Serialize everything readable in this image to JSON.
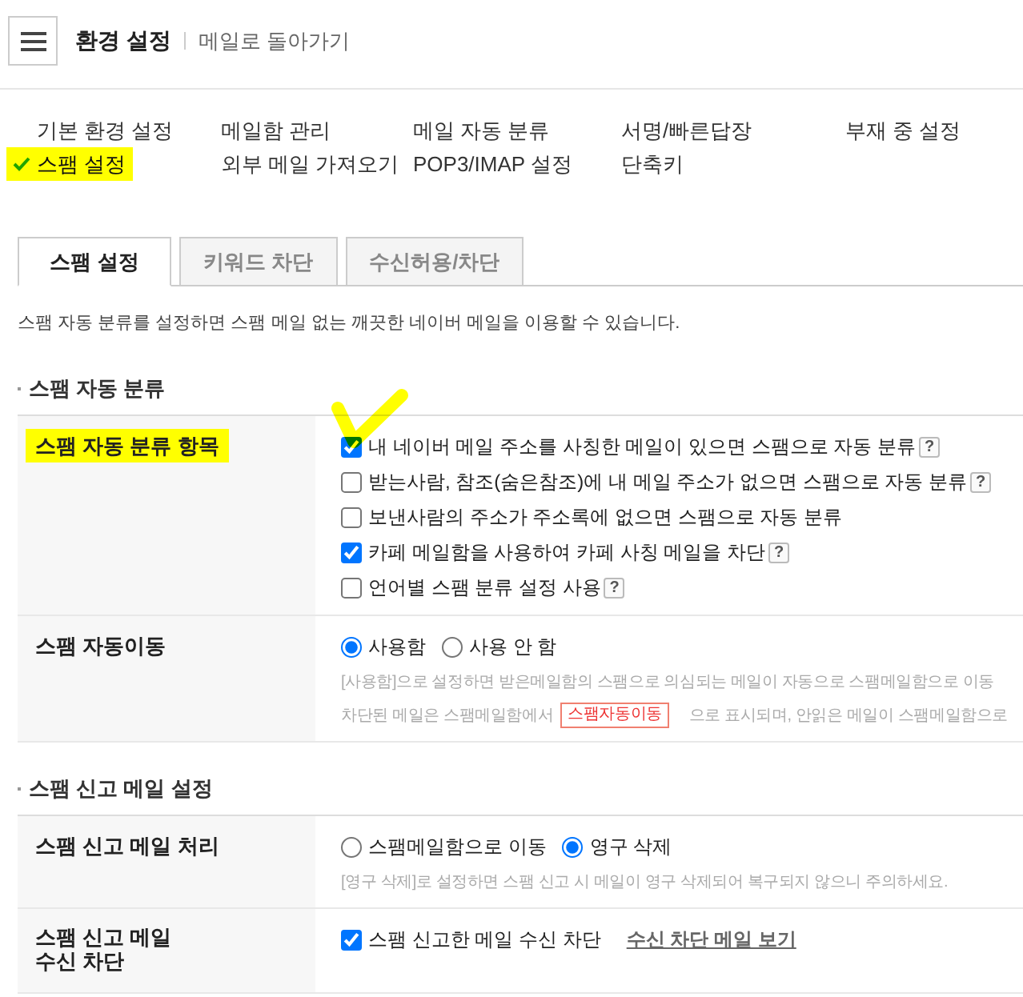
{
  "header": {
    "title": "환경 설정",
    "back_link": "메일로 돌아가기"
  },
  "nav": {
    "items": [
      {
        "label": "기본 환경 설정",
        "selected": false,
        "highlighted": false
      },
      {
        "label": "메일함 관리",
        "selected": false,
        "highlighted": false
      },
      {
        "label": "메일 자동 분류",
        "selected": false,
        "highlighted": false
      },
      {
        "label": "서명/빠른답장",
        "selected": false,
        "highlighted": false
      },
      {
        "label": "부재 중 설정",
        "selected": false,
        "highlighted": false
      },
      {
        "label": "스팸 설정",
        "selected": true,
        "highlighted": true
      },
      {
        "label": "외부 메일 가져오기",
        "selected": false,
        "highlighted": false
      },
      {
        "label": "POP3/IMAP 설정",
        "selected": false,
        "highlighted": false
      },
      {
        "label": "단축키",
        "selected": false,
        "highlighted": false
      }
    ]
  },
  "tabs": [
    {
      "label": "스팸 설정",
      "selected": true
    },
    {
      "label": "키워드 차단",
      "selected": false
    },
    {
      "label": "수신허용/차단",
      "selected": false
    }
  ],
  "description": "스팸 자동 분류를 설정하면 스팸 메일 없는 깨끗한 네이버 메일을 이용할 수 있습니다.",
  "sections": [
    {
      "title": "스팸 자동 분류",
      "rows": [
        {
          "label": "스팸 자동 분류 항목",
          "highlighted": true,
          "kind": "checklist",
          "options": [
            {
              "label": "내 네이버 메일 주소를 사칭한 메일이 있으면 스팸으로 자동 분류",
              "checked": true,
              "help": "?",
              "marked": true
            },
            {
              "label": "받는사람, 참조(숨은참조)에 내 메일 주소가 없으면 스팸으로 자동 분류",
              "checked": false,
              "help": "?",
              "marked": false
            },
            {
              "label": "보낸사람의 주소가 주소록에 없으면 스팸으로 자동 분류",
              "checked": false,
              "marked": false
            },
            {
              "label": "카페 메일함을 사용하여 카페 사칭 메일을 차단",
              "checked": true,
              "help": "?",
              "marked": false
            },
            {
              "label": "언어별 스팸 분류 설정 사용",
              "checked": false,
              "help": "?",
              "marked": false
            }
          ]
        },
        {
          "label": "스팸 자동이동",
          "highlighted": false,
          "kind": "radio",
          "options": [
            {
              "label": "사용함",
              "selected": true
            },
            {
              "label": "사용 안 함",
              "selected": false
            }
          ],
          "notes": [
            [
              {
                "kind": "text",
                "text": "[사용함]으로 설정하면 받은메일함의 스팸으로 의심되는 메일이 자동으로 스팸메일함으로 이동"
              }
            ],
            [
              {
                "kind": "text",
                "text": "차단된 메일은 스팸메일함에서"
              },
              {
                "kind": "tag",
                "text": "스팸자동이동"
              },
              {
                "kind": "text",
                "text": "으로 표시되며, 안읽은 메일이 스팸메일함으로"
              }
            ]
          ]
        }
      ]
    },
    {
      "title": "스팸 신고 메일 설정",
      "rows": [
        {
          "label": "스팸 신고 메일 처리",
          "highlighted": false,
          "kind": "radio",
          "options": [
            {
              "label": "스팸메일함으로 이동",
              "selected": false
            },
            {
              "label": "영구 삭제",
              "selected": true
            }
          ],
          "notes": [
            [
              {
                "kind": "text",
                "text": "[영구 삭제]로 설정하면 스팸 신고 시 메일이 영구 삭제되어 복구되지 않으니 주의하세요."
              }
            ]
          ]
        },
        {
          "label": "스팸 신고 메일\n수신 차단",
          "highlighted": false,
          "kind": "checklist",
          "options": [
            {
              "label": "스팸 신고한 메일 수신 차단",
              "checked": true,
              "marked": false
            }
          ],
          "link": "수신 차단 메일 보기"
        }
      ]
    }
  ]
}
